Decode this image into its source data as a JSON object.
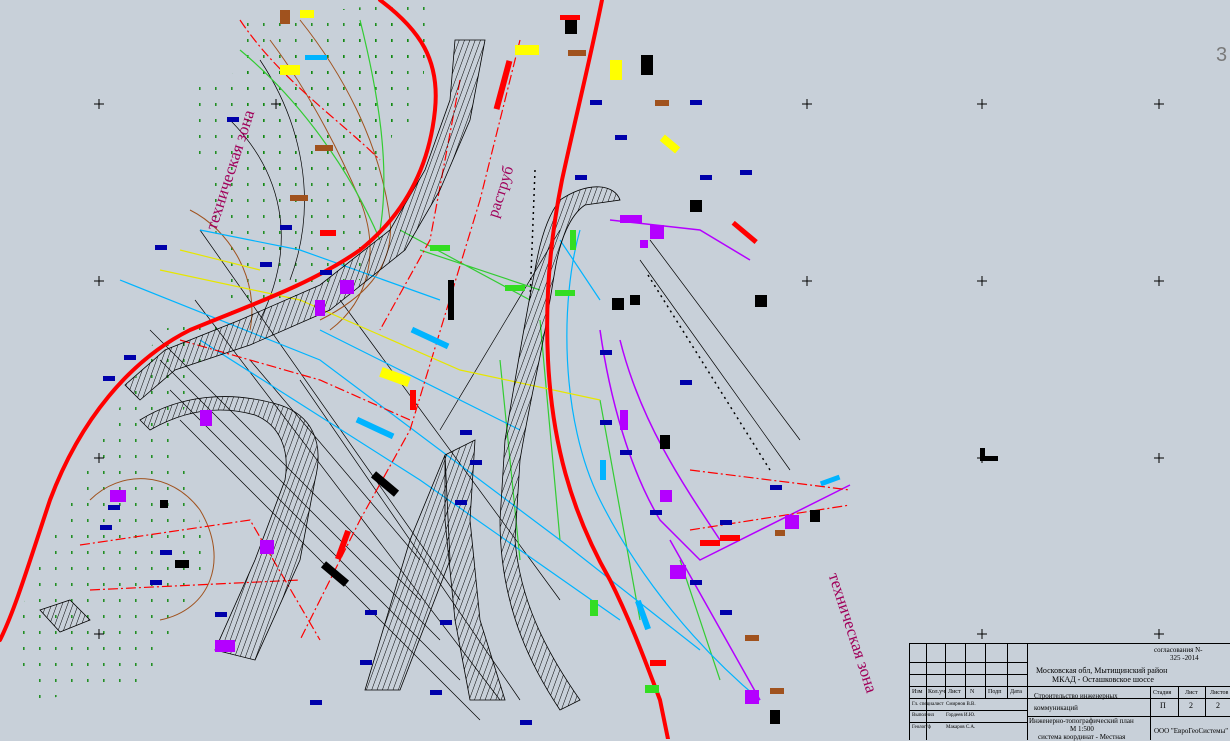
{
  "drawing": {
    "zone_label_left": "техническая зона",
    "zone_label_right": "техническая зона",
    "diffuser_label": "раструб",
    "sheet_edge_number": "3",
    "colors": {
      "background": "#c8d0d9",
      "road_axis": "#ff0000",
      "boundary": "#ff0000",
      "comm_blue": "#0000aa",
      "comm_magenta": "#b400ff",
      "comm_cyan": "#00b4ff",
      "comm_green": "#33cc33",
      "comm_yellow": "#ffff00",
      "comm_brown": "#a0521e",
      "zone_text": "#a0005a",
      "hatch": "#000000"
    }
  },
  "title_block": {
    "doc_number_line1": "согласования N-",
    "doc_number_line2": "325 -2014",
    "location_line1": "Московская обл, Мытищинский район",
    "location_line2": "МКАД - Осташковское шоссе",
    "header_cols": [
      "Изм",
      "Кол.уч",
      "Лист",
      "N",
      "Подп",
      "Дата"
    ],
    "work_title_line1": "Строительство инженерных",
    "work_title_line2": "коммуникаций",
    "stage_label": "Стадия",
    "sheet_label": "Лист",
    "sheets_label": "Листов",
    "stage_value": "П",
    "sheet_value": "2",
    "sheets_value": "2",
    "row_roles": [
      "Гл. специалист",
      "Выполнил",
      "Геолог/ф"
    ],
    "row_names": [
      "Смирнов В.В.",
      "Гордеев И.Ю.",
      "Макаров С.А."
    ],
    "plan_title_line1": "Инженерно-топографический план",
    "plan_title_line2": "М 1:500",
    "plan_title_line3": "система координат - Местная",
    "company": "ООО \"ЕвроГеоСистемы\""
  }
}
